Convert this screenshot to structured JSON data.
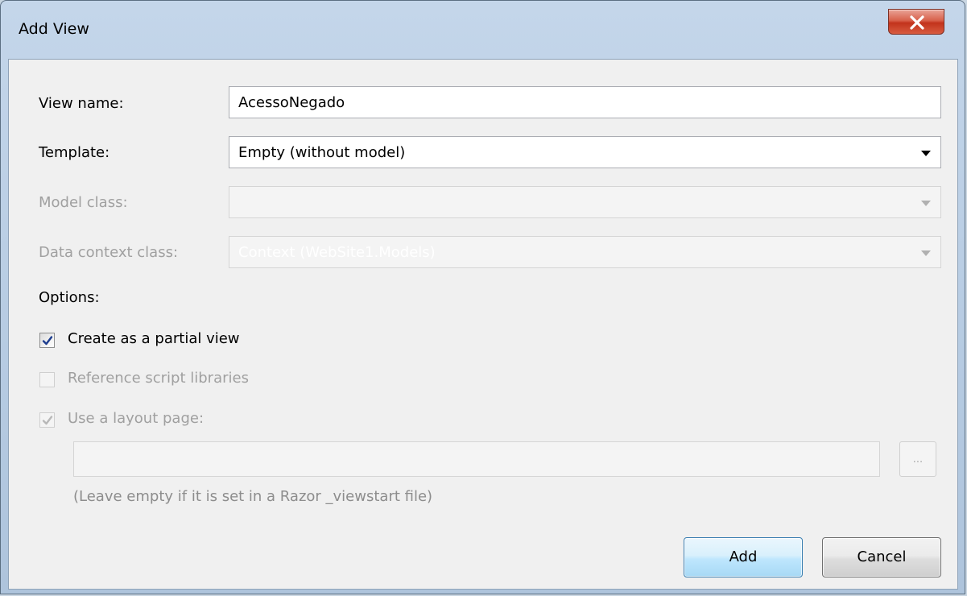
{
  "window": {
    "title": "Add View",
    "ghost_text": "",
    "close_glyph": "x"
  },
  "form": {
    "view_name": {
      "label": "View name:",
      "value": "AcessoNegado"
    },
    "template": {
      "label": "Template:",
      "value": "Empty (without model)"
    },
    "model_class": {
      "label": "Model class:",
      "value": ""
    },
    "data_context_class": {
      "label": "Data context class:",
      "value": "Context (WebSite1.Models)"
    }
  },
  "options": {
    "heading": "Options:",
    "partial_view": {
      "label": "Create as a partial view",
      "checked": true,
      "enabled": true
    },
    "reference_scripts": {
      "label": "Reference script libraries",
      "checked": false,
      "enabled": false
    },
    "use_layout": {
      "label": "Use a layout page:",
      "checked": true,
      "enabled": false
    },
    "layout_path": {
      "value": ""
    },
    "browse_label": "...",
    "hint": "(Leave empty if it is set in a Razor _viewstart file)"
  },
  "buttons": {
    "add_label": "Add",
    "cancel_label": "Cancel"
  },
  "colors": {
    "dialog_bg": "#f0f0f0",
    "frame": "#b6cbe2",
    "close_red": "#c2331c",
    "default_button_border": "#3c7fb1",
    "disabled_text": "#a0a0a0"
  },
  "icons": {
    "close": "close-icon",
    "dropdown": "chevron-down-icon",
    "check": "checkmark-icon"
  }
}
